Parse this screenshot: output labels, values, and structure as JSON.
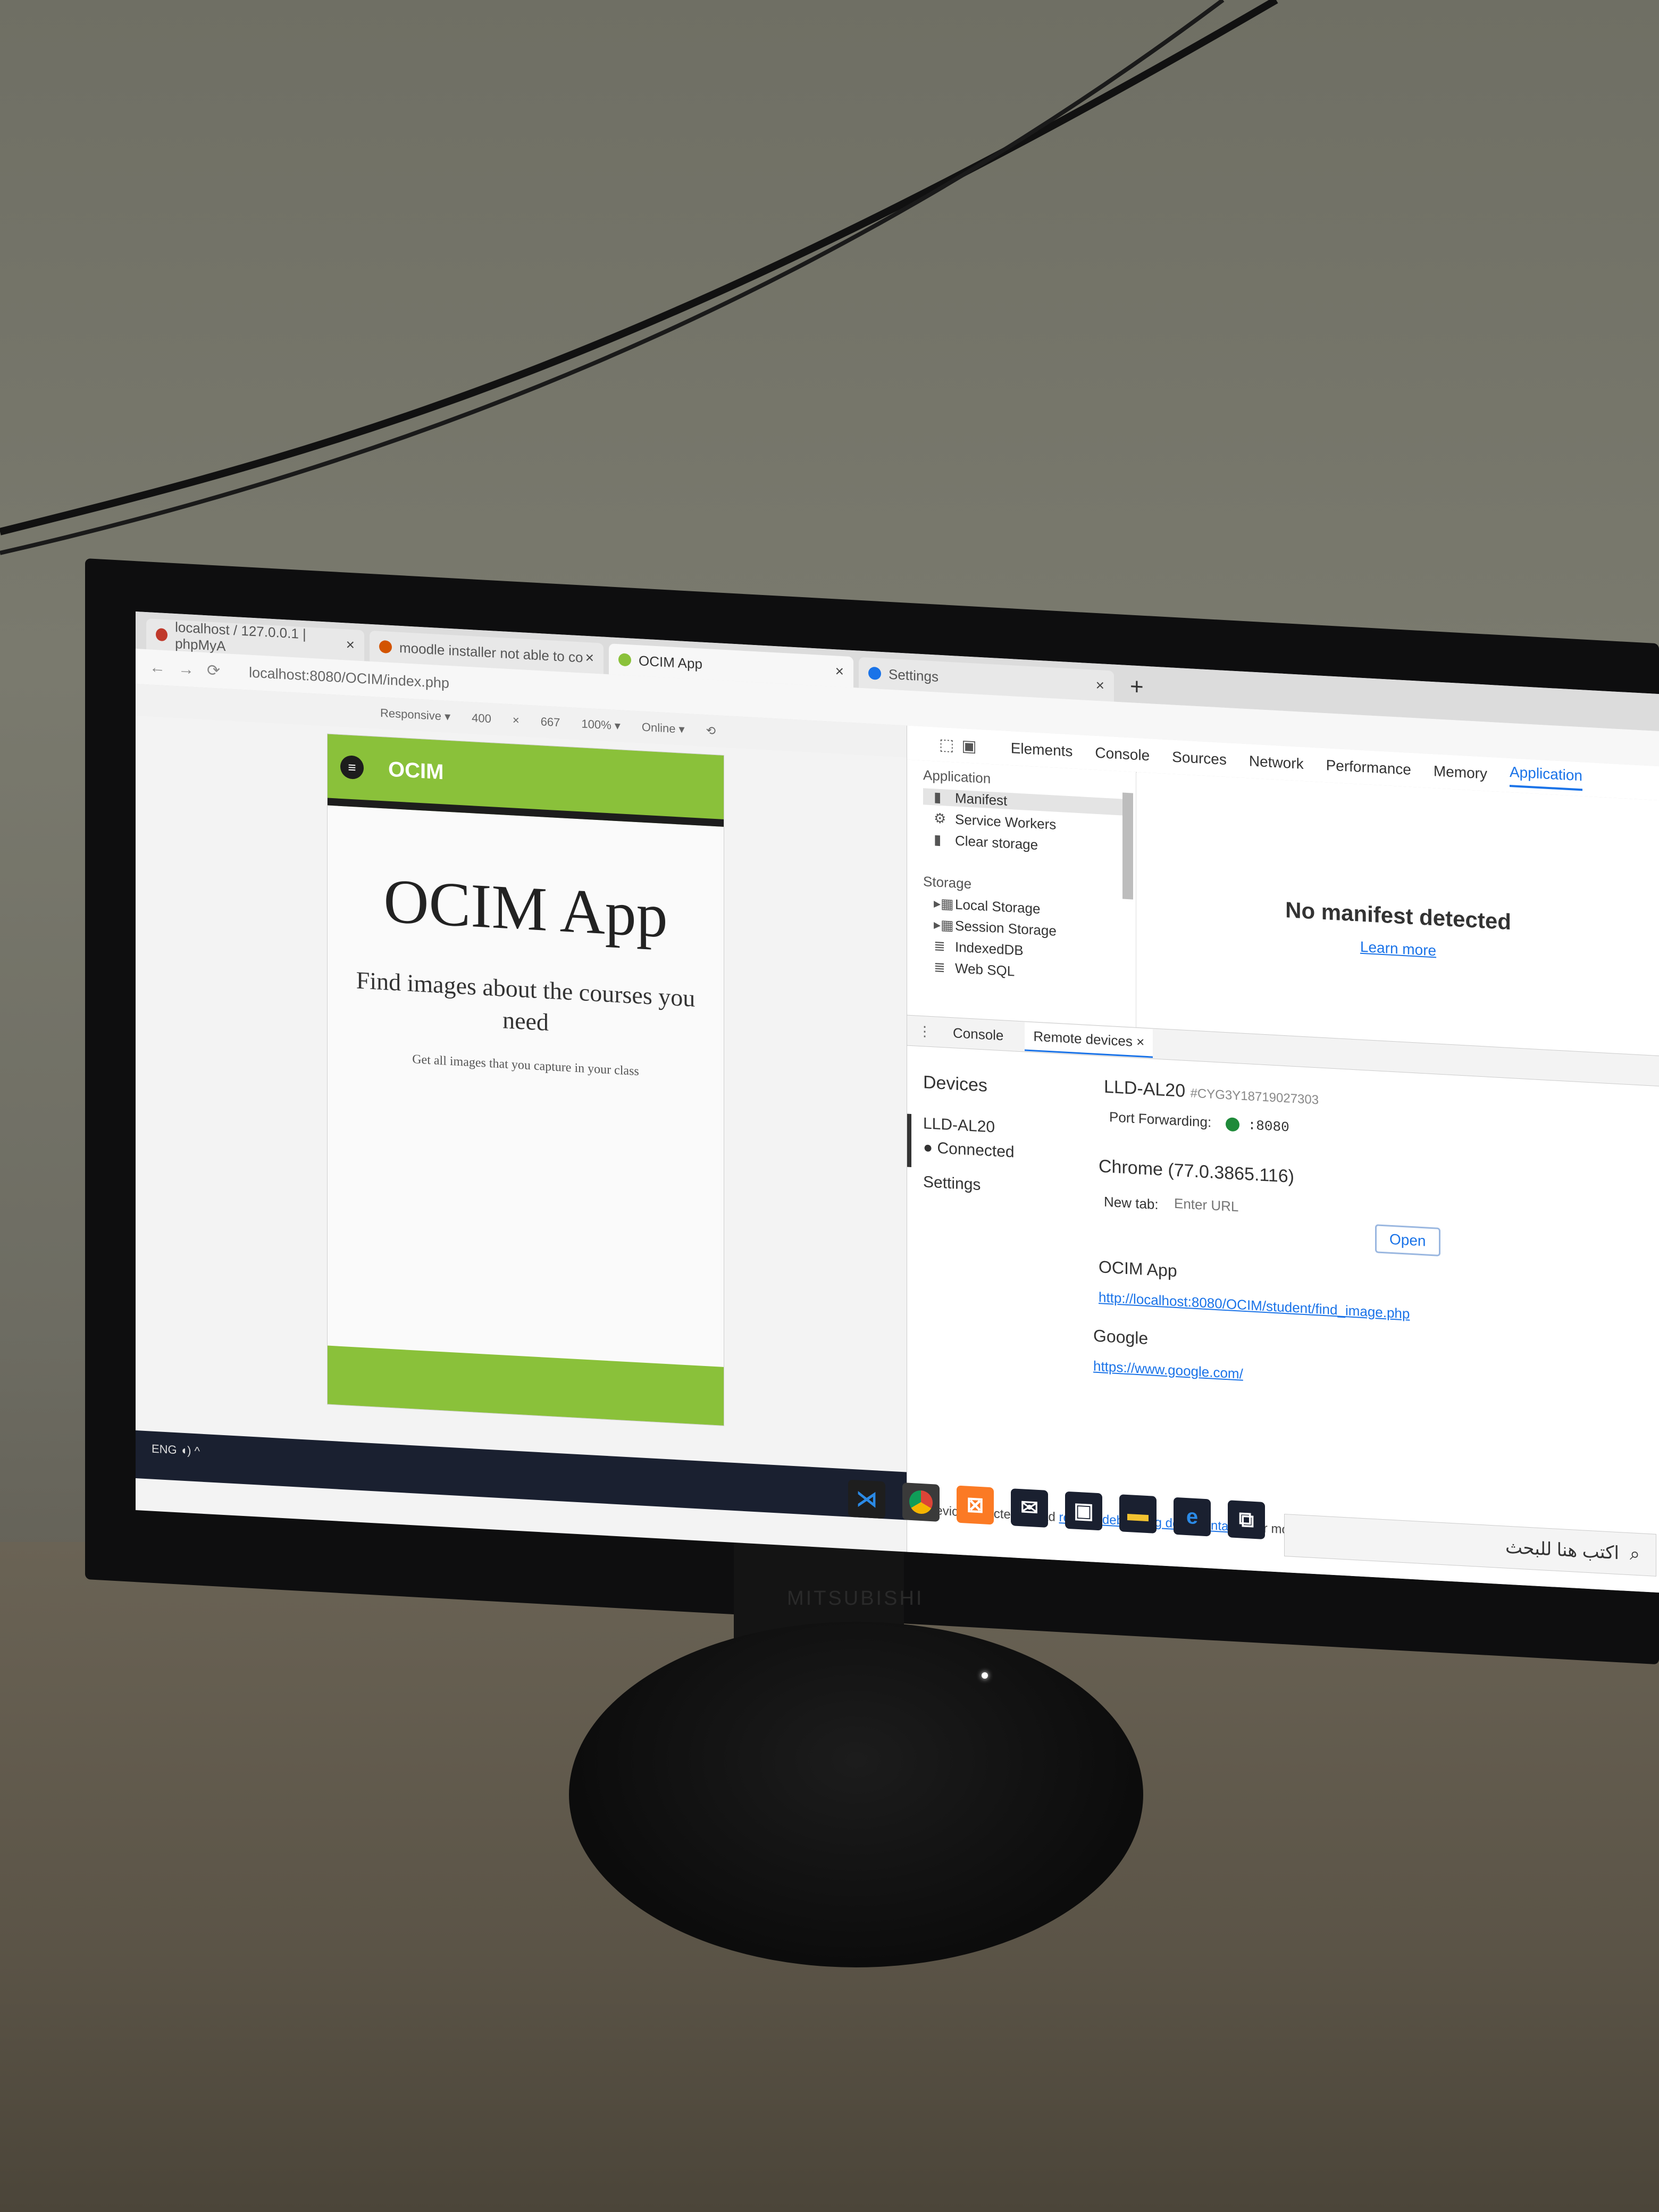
{
  "browser": {
    "tabs": [
      {
        "label": "localhost / 127.0.0.1 | phpMyA",
        "color": "#c0392b"
      },
      {
        "label": "moodle installer not able to co",
        "color": "#d35400"
      },
      {
        "label": "OCIM App",
        "color": "#8ac13a",
        "active": true
      },
      {
        "label": "Settings",
        "color": "#1a73e8"
      }
    ],
    "url": "localhost:8080/OCIM/index.php",
    "device_toolbar": {
      "mode": "Responsive ▾",
      "width": "400",
      "times": "×",
      "height": "667",
      "zoom": "100% ▾",
      "network": "Online ▾"
    }
  },
  "app": {
    "brand": "OCIM",
    "title": "OCIM App",
    "subtitle": "Find images about the courses you need",
    "tagline": "Get all images that you capture in your class",
    "accent": "#8ac13a"
  },
  "devtools": {
    "tabs": [
      "Elements",
      "Console",
      "Sources",
      "Network",
      "Performance",
      "Memory",
      "Application"
    ],
    "active_tab": "Application",
    "sidebar": {
      "application_heading": "Application",
      "application_items": [
        "Manifest",
        "Service Workers",
        "Clear storage"
      ],
      "storage_heading": "Storage",
      "storage_items": [
        "Local Storage",
        "Session Storage",
        "IndexedDB",
        "Web SQL"
      ]
    },
    "manifest": {
      "message": "No manifest detected",
      "learn_more": "Learn more"
    },
    "drawer": {
      "tabs": [
        "Console",
        "Remote devices"
      ],
      "left": {
        "heading": "Devices",
        "device": "LLD-AL20",
        "status": "Connected",
        "settings": "Settings"
      },
      "device_name": "LLD-AL20",
      "device_serial": "#CYG3Y18719027303",
      "port_forwarding_label": "Port Forwarding:",
      "port": ":8080",
      "chrome_version": "Chrome (77.0.3865.116)",
      "new_tab_label": "New tab:",
      "new_tab_placeholder": "Enter URL",
      "open_label": "Open",
      "pages": [
        {
          "title": "OCIM App",
          "url": "http://localhost:8080/OCIM/student/find_image.php"
        },
        {
          "title": "Google",
          "url": "https://www.google.com/"
        }
      ],
      "status_prefix": "1 device detected. Read ",
      "status_link": "remote debugging documentation",
      "status_suffix": " for more information."
    }
  },
  "taskbar": {
    "search_placeholder": "اكتب هنا للبحث",
    "tray_lang": "ENG",
    "icons": [
      "vscode-icon",
      "chrome-icon",
      "xampp-icon",
      "mail-icon",
      "store-icon",
      "explorer-icon",
      "edge-icon",
      "taskview-icon"
    ]
  },
  "monitor": {
    "brand": "MITSUBISHI"
  }
}
